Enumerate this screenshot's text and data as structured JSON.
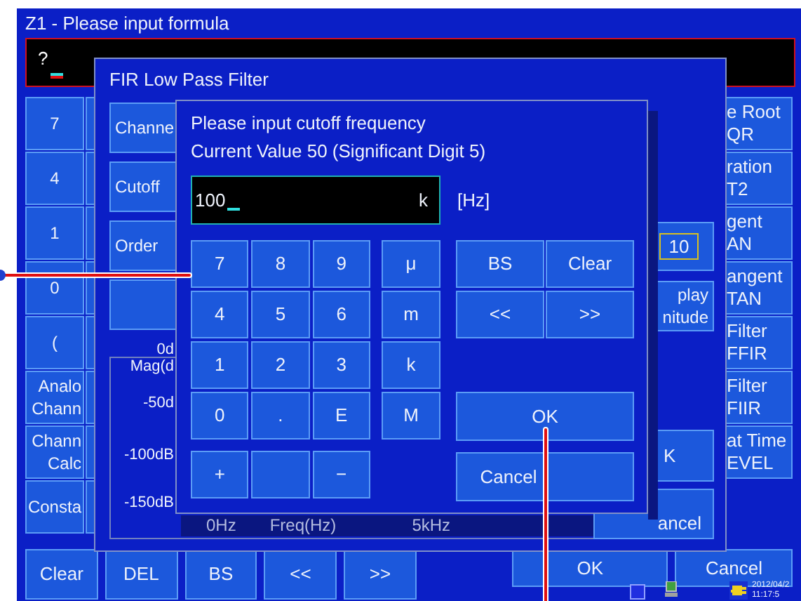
{
  "formula_window": {
    "title": "Z1 - Please input formula",
    "formula": "?",
    "left_keys": [
      {
        "lines": [
          "7"
        ]
      },
      {
        "lines": [
          "4"
        ]
      },
      {
        "lines": [
          "1"
        ]
      },
      {
        "lines": [
          "0"
        ]
      },
      {
        "lines": [
          "("
        ]
      },
      {
        "lines": [
          "Analo",
          "Chann"
        ]
      },
      {
        "lines": [
          "Chann",
          "Calc"
        ]
      },
      {
        "lines": [
          "Consta"
        ]
      }
    ],
    "right_keys": [
      {
        "lines": [
          "e Root",
          "QR"
        ]
      },
      {
        "lines": [
          "ration",
          "T2"
        ]
      },
      {
        "lines": [
          "gent",
          "AN"
        ]
      },
      {
        "lines": [
          "angent",
          "TAN"
        ]
      },
      {
        "lines": [
          "Filter",
          "FFIR"
        ]
      },
      {
        "lines": [
          "Filter",
          "FIIR"
        ]
      },
      {
        "lines": [
          "at Time",
          "EVEL"
        ]
      }
    ],
    "bottom_keys": [
      "Clear",
      "DEL",
      "BS",
      "<<",
      ">>"
    ],
    "ok": "OK",
    "cancel": "Cancel",
    "status": {
      "date": "2012/04/2",
      "time": "11:17:5"
    }
  },
  "fir_dialog": {
    "title": "FIR Low Pass Filter",
    "settings": [
      "Channe",
      "Cutoff",
      "Order"
    ],
    "graph": {
      "y_labels": [
        [
          "0d",
          "Mag(d"
        ],
        [
          "-50d"
        ],
        [
          "-100dB"
        ],
        [
          "-150dB"
        ]
      ],
      "x_labels": [
        "0Hz",
        "Freq(Hz)",
        "5kHz"
      ]
    },
    "order_value": "10",
    "display_button": [
      "play",
      "nitude"
    ],
    "ok": "K",
    "cancel": "ancel"
  },
  "input_dialog": {
    "prompt": "Please input cutoff frequency",
    "current": "Current Value 50 (Significant Digit 5)",
    "value": "100",
    "prefix": "k",
    "unit": "[Hz]",
    "digits": [
      "7",
      "8",
      "9",
      "4",
      "5",
      "6",
      "1",
      "2",
      "3",
      "0",
      ".",
      "E"
    ],
    "prefixes": [
      "μ",
      "m",
      "k",
      "M"
    ],
    "ops": [
      {
        "kind": "key",
        "label": "+"
      },
      {
        "kind": "blank"
      },
      {
        "kind": "key",
        "label": "−"
      }
    ],
    "edit_keys": [
      "BS",
      "Clear",
      "<<",
      ">>"
    ],
    "ok": "OK",
    "cancel": "Cancel"
  }
}
